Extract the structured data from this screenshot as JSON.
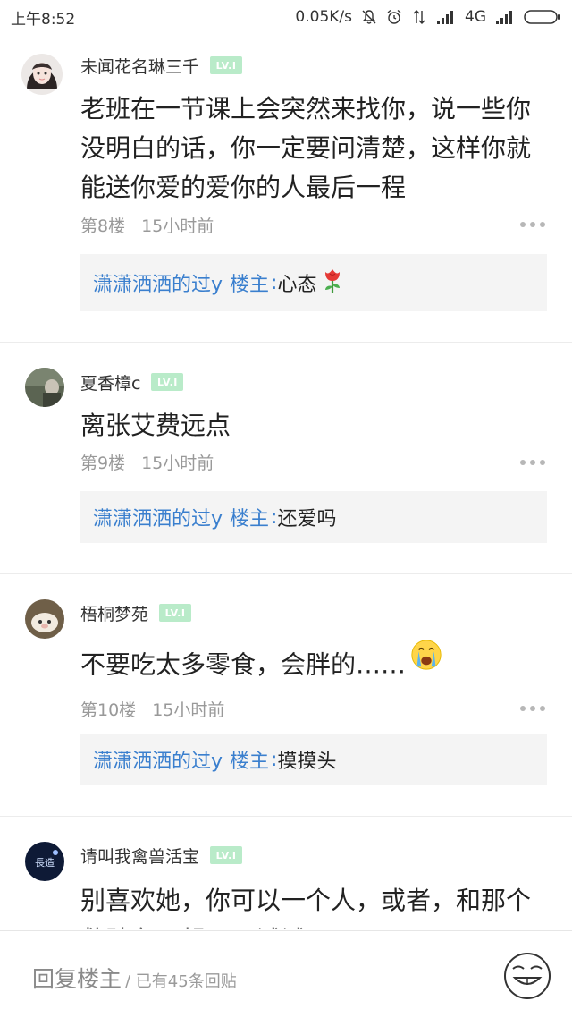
{
  "status_bar": {
    "time": "上午8:52",
    "net_speed": "0.05K/s",
    "network": "4G"
  },
  "posts": [
    {
      "username": "未闻花名琳三千",
      "level": "LV.I",
      "content": "老班在一节课上会突然来找你，说一些你没明白的话，你一定要问清楚，这样你就能送你爱的爱你的人最后一程",
      "floor": "第8楼",
      "time": "15小时前",
      "reply": {
        "author": "潇潇洒洒的过y",
        "tag": "楼主",
        "colon": ":",
        "text": " 心态",
        "emoji": "rose-emoji"
      }
    },
    {
      "username": "夏香樟c",
      "level": "LV.I",
      "content": "离张艾费远点",
      "floor": "第9楼",
      "time": "15小时前",
      "reply": {
        "author": "潇潇洒洒的过y",
        "tag": "楼主",
        "colon": ":",
        "text": " 还爱吗"
      }
    },
    {
      "username": "梧桐梦苑",
      "level": "LV.I",
      "content": "不要吃太多零食，会胖的……",
      "content_emoji": "crying-face-emoji",
      "floor": "第10楼",
      "time": "15小时前",
      "reply": {
        "author": "潇潇洒洒的过y",
        "tag": "楼主",
        "colon": ":",
        "text": " 摸摸头"
      }
    },
    {
      "username": "请叫我禽兽活宝",
      "level": "LV.I",
      "content": "别喜欢她，你可以一个人，或者，和那个救赎在一起吧，试试。"
    }
  ],
  "bottom_bar": {
    "input_label": "回复楼主",
    "post_count": "/ 已有45条回贴",
    "emoji_icon": "grin-face-icon"
  },
  "colors": {
    "accent_blue": "#3a7fce",
    "level_badge": "#b9ebc9",
    "reply_bg": "#f4f4f4"
  }
}
